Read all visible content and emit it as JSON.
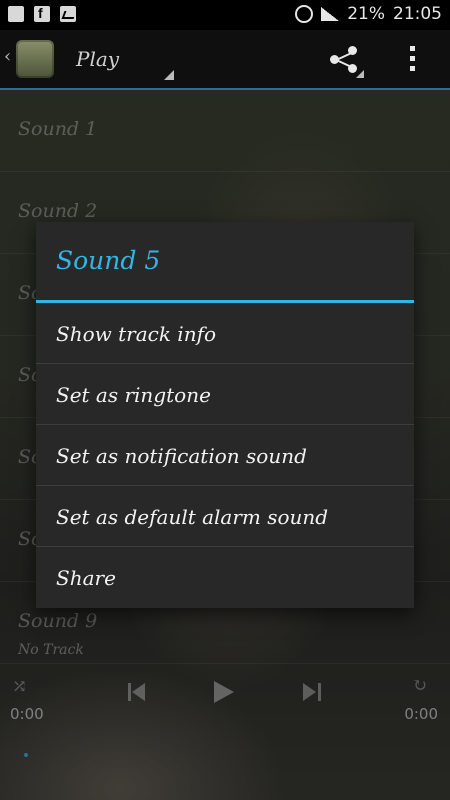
{
  "status_bar": {
    "battery": "21%",
    "time": "21:05"
  },
  "action_bar": {
    "title": "Play"
  },
  "list": {
    "items": [
      "Sound 1",
      "Sound 2",
      "So",
      "So",
      "So",
      "So",
      "Sound 9"
    ]
  },
  "player": {
    "track": "No Track",
    "time_elapsed": "0:00",
    "time_total": "0:00"
  },
  "dialog": {
    "title": "Sound 5",
    "items": [
      "Show track info",
      "Set as ringtone",
      "Set as notification sound",
      "Set as default alarm sound",
      "Share"
    ]
  },
  "colors": {
    "accent": "#33b5e5",
    "dialog_bg": "#282828"
  }
}
